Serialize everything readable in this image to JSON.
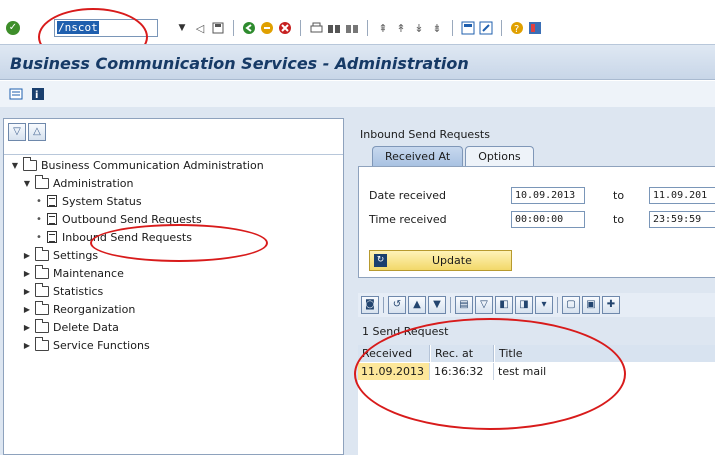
{
  "system_toolbar": {
    "command_field_value": "/nscot",
    "icons": [
      "enter-icon",
      "back-icon",
      "save-icon",
      "back-green-icon",
      "exit-icon",
      "cancel-icon",
      "print-icon",
      "find-icon",
      "find-next-icon",
      "first-page-icon",
      "prev-page-icon",
      "next-page-icon",
      "last-page-icon",
      "new-session-icon",
      "shortcut-icon",
      "help-icon",
      "layout-icon"
    ]
  },
  "title": "Business Communication Services - Administration",
  "app_toolbar": {
    "icons": [
      "layout-icon",
      "info-icon"
    ]
  },
  "tree": {
    "root": "Business Communication Administration",
    "administration": "Administration",
    "items": [
      "System Status",
      "Outbound Send Requests",
      "Inbound Send Requests"
    ],
    "folders": [
      "Settings",
      "Maintenance",
      "Statistics",
      "Reorganization",
      "Delete Data",
      "Service Functions"
    ]
  },
  "right": {
    "heading": "Inbound Send Requests",
    "tabs": [
      "Received At",
      "Options"
    ],
    "form": {
      "date_label": "Date received",
      "date_from": "10.09.2013",
      "date_to": "11.09.201",
      "time_label": "Time received",
      "time_from": "00:00:00",
      "time_to": "23:59:59",
      "to": "to"
    },
    "update_button": "Update",
    "list_title": "1 Send Request",
    "grid": {
      "columns": [
        "Received",
        "Rec. at",
        "Title"
      ],
      "rows": [
        [
          "11.09.2013",
          "16:36:32",
          "test mail"
        ]
      ]
    }
  },
  "colors": {
    "annotation_red": "#d81b1b",
    "title_blue": "#163a66",
    "selected_cell": "#fde79a"
  }
}
